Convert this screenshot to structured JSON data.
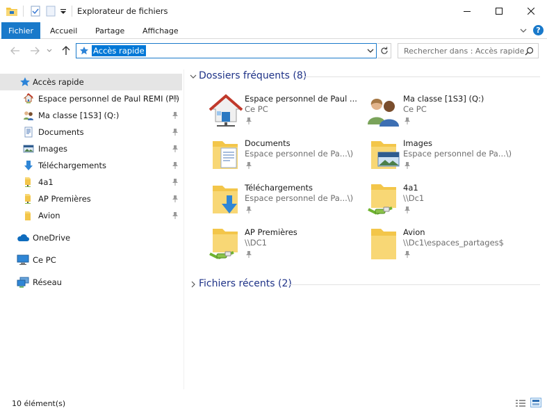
{
  "window": {
    "title": "Explorateur de fichiers"
  },
  "ribbon": {
    "tabs": [
      "Fichier",
      "Accueil",
      "Partage",
      "Affichage"
    ],
    "help": "?"
  },
  "address": {
    "path": "Accès rapide"
  },
  "search": {
    "placeholder": "Rechercher dans : Accès rapide"
  },
  "nav": {
    "quick_access": "Accès rapide",
    "items": [
      {
        "label": "Espace personnel de Paul REMI (P:)",
        "icon": "home-network-icon"
      },
      {
        "label": "Ma classe [1S3] (Q:)",
        "icon": "users-icon"
      },
      {
        "label": "Documents",
        "icon": "documents-icon"
      },
      {
        "label": "Images",
        "icon": "images-icon"
      },
      {
        "label": "Téléchargements",
        "icon": "download-icon"
      },
      {
        "label": "4a1",
        "icon": "folder-icon"
      },
      {
        "label": "AP Premières",
        "icon": "folder-icon"
      },
      {
        "label": "Avion",
        "icon": "folder-icon"
      }
    ],
    "onedrive": "OneDrive",
    "thispc": "Ce PC",
    "network": "Réseau"
  },
  "content": {
    "frequent_header": "Dossiers fréquents (8)",
    "recent_header": "Fichiers récents (2)",
    "tiles": [
      {
        "name": "Espace personnel de Paul ...",
        "sub": "Ce PC",
        "icon": "home-network-icon"
      },
      {
        "name": "Ma classe [1S3] (Q:)",
        "sub": "Ce PC",
        "icon": "users-icon"
      },
      {
        "name": "Documents",
        "sub": "Espace personnel de Pa...\\)",
        "icon": "documents-folder-icon"
      },
      {
        "name": "Images",
        "sub": "Espace personnel de Pa...\\)",
        "icon": "images-folder-icon"
      },
      {
        "name": "Téléchargements",
        "sub": "Espace personnel de Pa...\\)",
        "icon": "downloads-folder-icon"
      },
      {
        "name": "4a1",
        "sub": "\\\\Dc1",
        "icon": "network-folder-icon"
      },
      {
        "name": "AP Premières",
        "sub": "\\\\DC1",
        "icon": "network-folder-icon"
      },
      {
        "name": "Avion",
        "sub": "\\\\Dc1\\espaces_partages$",
        "icon": "folder-icon"
      }
    ]
  },
  "status": {
    "count": "10 élément(s)"
  },
  "colors": {
    "accent": "#1979ca",
    "selection": "#e5e5e5",
    "header_text": "#1e3287",
    "folder": "#f8d775"
  }
}
